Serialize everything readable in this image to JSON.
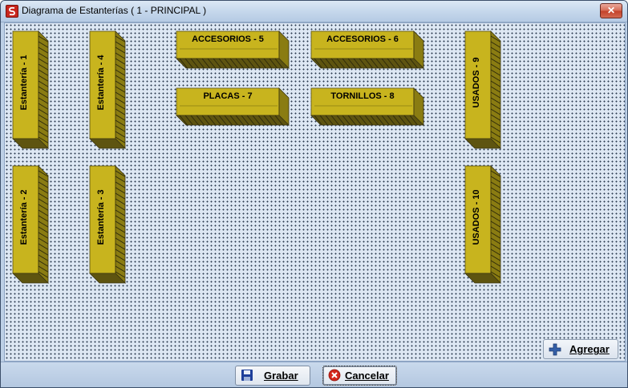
{
  "window": {
    "title": "Diagrama de Estanterías ( 1 - PRINCIPAL )",
    "close_glyph": "✕"
  },
  "shelves": [
    {
      "id": "estanteria-1",
      "label": "Estantería - 1",
      "orientation": "vertical"
    },
    {
      "id": "estanteria-4",
      "label": "Estantería - 4",
      "orientation": "vertical"
    },
    {
      "id": "accesorios-5",
      "label": "ACCESORIOS - 5",
      "orientation": "horizontal"
    },
    {
      "id": "accesorios-6",
      "label": "ACCESORIOS - 6",
      "orientation": "horizontal"
    },
    {
      "id": "usados-9",
      "label": "USADOS - 9",
      "orientation": "vertical"
    },
    {
      "id": "placas-7",
      "label": "PLACAS - 7",
      "orientation": "horizontal"
    },
    {
      "id": "tornillos-8",
      "label": "TORNILLOS - 8",
      "orientation": "horizontal"
    },
    {
      "id": "estanteria-2",
      "label": "Estantería - 2",
      "orientation": "vertical"
    },
    {
      "id": "estanteria-3",
      "label": "Estantería - 3",
      "orientation": "vertical"
    },
    {
      "id": "usados-10",
      "label": "USADOS - 10",
      "orientation": "vertical"
    }
  ],
  "buttons": {
    "agregar": "Agregar",
    "grabar": "Grabar",
    "cancelar": "Cancelar"
  },
  "colors": {
    "shelf_front": "#c8b41e",
    "shelf_side": "#8a7c12",
    "shelf_top": "#ddd046",
    "canvas_bg": "#dde7f3"
  },
  "icons": {
    "app": "app-logo-icon",
    "agregar": "plus-icon",
    "grabar": "floppy-disk-icon",
    "cancelar": "cancel-x-icon"
  }
}
